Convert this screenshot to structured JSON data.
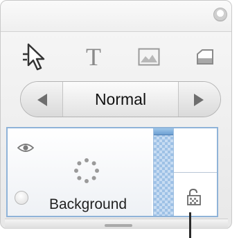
{
  "toolbar": {
    "tools": [
      {
        "name": "pointer",
        "icon": "pointer-icon"
      },
      {
        "name": "text",
        "icon": "text-icon",
        "glyph": "T"
      },
      {
        "name": "image",
        "icon": "image-icon"
      },
      {
        "name": "shape",
        "icon": "shape-icon"
      }
    ]
  },
  "blend_mode": {
    "selected": "Normal",
    "prev_icon": "arrow-left-icon",
    "next_icon": "arrow-right-icon"
  },
  "layers": [
    {
      "name": "Background",
      "visible": true,
      "locked": false,
      "icons": [
        "eye-icon",
        "loading-spinner-icon",
        "radio-icon",
        "unlocked-padlock-icon"
      ]
    }
  ],
  "colors": {
    "selection_border": "#8fb3d8",
    "strip_fill": "#c7dcf2",
    "panel_bg": "#efefef"
  }
}
